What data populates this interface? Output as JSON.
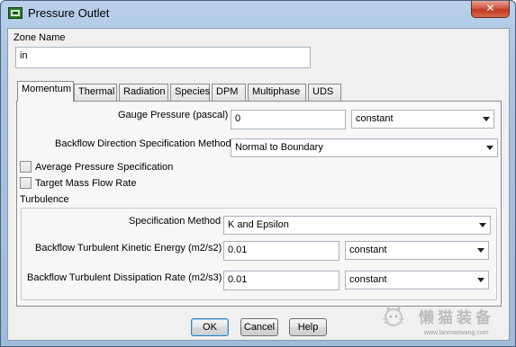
{
  "window": {
    "title": "Pressure Outlet",
    "close_glyph": "✕"
  },
  "zone": {
    "label": "Zone Name",
    "value": "in"
  },
  "tabs": [
    {
      "label": "Momentum",
      "active": true
    },
    {
      "label": "Thermal",
      "active": false
    },
    {
      "label": "Radiation",
      "active": false
    },
    {
      "label": "Species",
      "active": false
    },
    {
      "label": "DPM",
      "active": false
    },
    {
      "label": "Multiphase",
      "active": false
    },
    {
      "label": "UDS",
      "active": false
    }
  ],
  "momentum": {
    "gauge_pressure_label": "Gauge Pressure (pascal)",
    "gauge_pressure_value": "0",
    "gauge_pressure_method": "constant",
    "backflow_direction_label": "Backflow Direction Specification Method",
    "backflow_direction_value": "Normal to Boundary",
    "average_pressure_label": "Average Pressure Specification",
    "average_pressure_checked": false,
    "target_mass_flow_label": "Target Mass Flow Rate",
    "target_mass_flow_checked": false
  },
  "turbulence": {
    "group_label": "Turbulence",
    "spec_method_label": "Specification Method",
    "spec_method_value": "K and Epsilon",
    "tke_label": "Backflow Turbulent Kinetic Energy (m2/s2)",
    "tke_value": "0.01",
    "tke_method": "constant",
    "dissipation_label": "Backflow Turbulent Dissipation Rate (m2/s3)",
    "dissipation_value": "0.01",
    "dissipation_method": "constant"
  },
  "buttons": {
    "ok": "OK",
    "cancel": "Cancel",
    "help": "Help"
  },
  "watermark": {
    "text": "懒猫装备",
    "url": "www.lanmaowang.com"
  },
  "colors": {
    "title_bar": "#b9d1ea",
    "close_button": "#c0381f",
    "dialog_bg": "#f0f0f0"
  }
}
